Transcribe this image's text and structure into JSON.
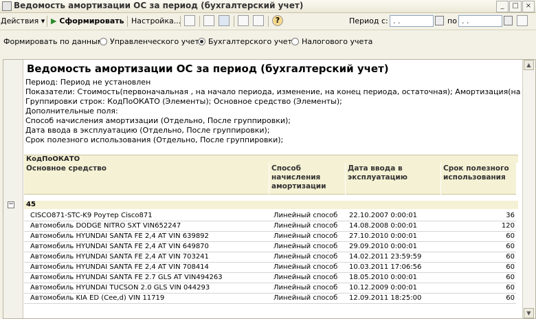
{
  "window": {
    "title": "Ведомость амортизации ОС за период (бухгалтерский учет)",
    "controls": [
      "_",
      "□",
      "×"
    ]
  },
  "toolbar": {
    "actions_label": "Действия",
    "form_label": "Сформировать",
    "settings_label": "Настройка...",
    "period_label": "Период с:",
    "period_from": ". .",
    "period_to_label": "по",
    "period_to": ". .",
    "help_glyph": "?"
  },
  "filter": {
    "label": "Формировать по данным:",
    "options": [
      "Управленческого учета",
      "Бухгалтерского учета",
      "Налогового учета"
    ],
    "selected": "Бухгалтерского учета"
  },
  "report": {
    "title": "Ведомость амортизации ОС за период (бухгалтерский учет)",
    "params": [
      "Период: Период не установлен",
      "Показатели: Стоимость(первоначальная , на начало периода, изменение, на конец периода, остаточная); Амортизация(на начало периода",
      "Группировки строк: КодПоОКАТО (Элементы); Основное средство (Элементы);",
      "Дополнительные поля:",
      "Способ начисления амортизации (Отдельно, После группировки);",
      "Дата ввода в эксплуатацию (Отдельно, После группировки);",
      "Срок полезного использования (Отдельно, После группировки);"
    ],
    "group_header": "КодПоОКАТО",
    "columns": [
      "Основное средство",
      "Способ начисления амортизации",
      "Дата ввода в эксплуатацию",
      "Срок полезного использования"
    ],
    "group_value": "45",
    "rows": [
      {
        "asset": "CISCO871-STC-K9 Роутер Cisco871",
        "method": "Линейный способ",
        "date": "22.10.2007 0:00:01",
        "term": "36"
      },
      {
        "asset": "Автомобиль DODGE NITRO SXT VIN652247",
        "method": "Линейный способ",
        "date": "14.08.2008 0:00:01",
        "term": "120"
      },
      {
        "asset": "Автомобиль HYUNDAI SANTA FE 2,4 AT VIN 639892",
        "method": "Линейный способ",
        "date": "27.10.2010 0:00:01",
        "term": "60"
      },
      {
        "asset": "Автомобиль HYUNDAI SANTA FE 2,4 AT VIN 649870",
        "method": "Линейный способ",
        "date": "29.09.2010 0:00:01",
        "term": "60"
      },
      {
        "asset": "Автомобиль HYUNDAI SANTA FE 2,4 AT VIN 703241",
        "method": "Линейный способ",
        "date": "14.02.2011 23:59:59",
        "term": "60"
      },
      {
        "asset": "Автомобиль HYUNDAI SANTA FE 2,4 AT VIN 708414",
        "method": "Линейный способ",
        "date": "10.03.2011 17:06:56",
        "term": "60"
      },
      {
        "asset": "Автомобиль HYUNDAI SANTA FE 2.7 GLS AT VIN494263",
        "method": "Линейный способ",
        "date": "18.05.2010 0:00:01",
        "term": "60"
      },
      {
        "asset": "Автомобиль HYUNDAI TUCSON 2.0 GLS VIN 044293",
        "method": "Линейный способ",
        "date": "10.12.2009 0:00:01",
        "term": "60"
      },
      {
        "asset": "Автомобиль KIA ED (Cee,d) VIN 11719",
        "method": "Линейный способ",
        "date": "12.09.2011 18:25:00",
        "term": "60"
      }
    ]
  },
  "colors": {
    "header_bg": "#f5f1d4",
    "chrome_bg": "#f3f1e6"
  }
}
